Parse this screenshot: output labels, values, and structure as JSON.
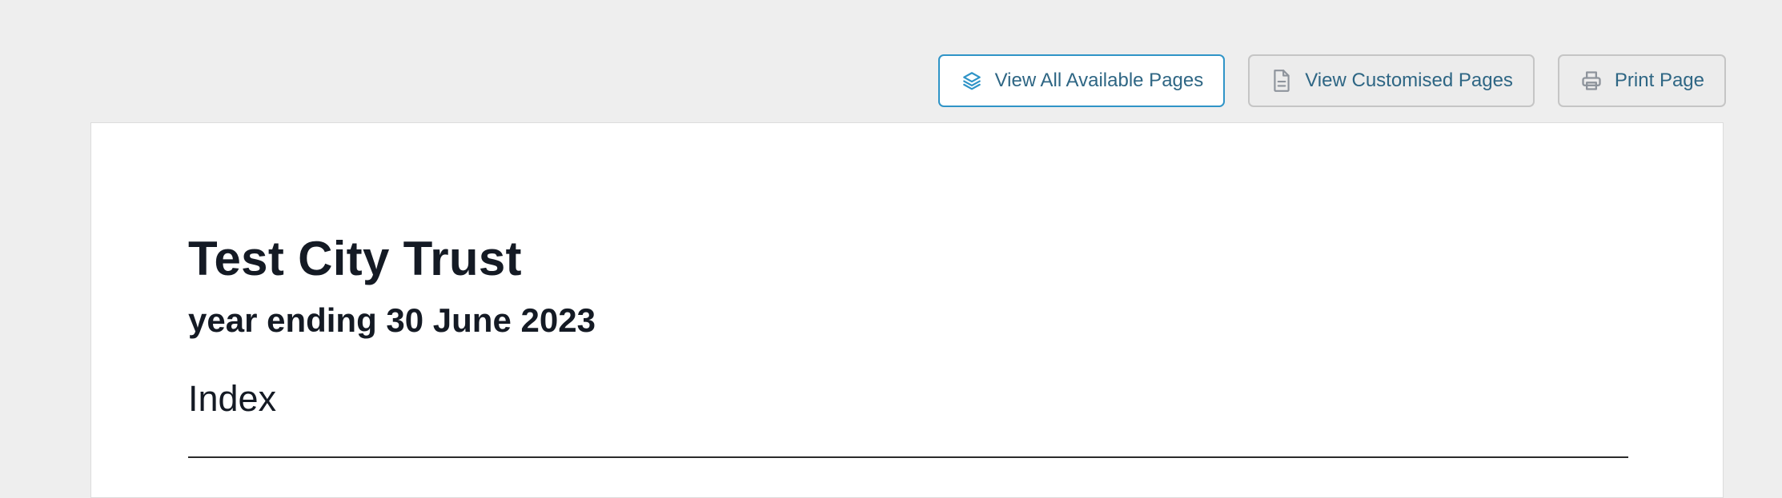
{
  "toolbar": {
    "view_all_label": "View All Available Pages",
    "view_custom_label": "View Customised Pages",
    "print_label": "Print Page",
    "icons": {
      "view_all": "layers-icon",
      "view_custom": "document-icon",
      "print": "printer-icon"
    }
  },
  "document": {
    "org_name": "Test City Trust",
    "period": "year ending 30 June 2023",
    "section_title": "Index"
  },
  "colors": {
    "page_background": "#eeeeee",
    "sheet_background": "#ffffff",
    "accent_border": "#2f94c7",
    "button_text": "#2e6684",
    "heading_text": "#141a24"
  }
}
